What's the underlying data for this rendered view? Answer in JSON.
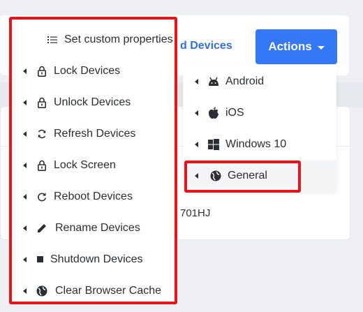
{
  "background": {
    "link_text": "d Devices",
    "row_code": "701HJ"
  },
  "actions_button": {
    "label": "Actions"
  },
  "submenu": {
    "items": [
      {
        "label": "Android",
        "icon": "android-icon"
      },
      {
        "label": "iOS",
        "icon": "apple-icon"
      },
      {
        "label": "Windows 10",
        "icon": "windows-icon"
      },
      {
        "label": "General",
        "icon": "globe-icon"
      }
    ],
    "active_index": 3
  },
  "menu": {
    "items": [
      {
        "label": "Set custom properties",
        "icon": "list-icon"
      },
      {
        "label": "Lock Devices",
        "icon": "lock-icon"
      },
      {
        "label": "Unlock Devices",
        "icon": "unlock-icon"
      },
      {
        "label": "Refresh Devices",
        "icon": "refresh-icon"
      },
      {
        "label": "Lock Screen",
        "icon": "lock-icon"
      },
      {
        "label": "Reboot Devices",
        "icon": "reboot-icon"
      },
      {
        "label": "Rename Devices",
        "icon": "pencil-icon"
      },
      {
        "label": "Shutdown Devices",
        "icon": "stop-icon"
      },
      {
        "label": "Clear Browser Cache",
        "icon": "globe-icon"
      }
    ]
  },
  "colors": {
    "accent": "#3478f6",
    "highlight": "#e8141b",
    "link": "#2f6fe4"
  }
}
